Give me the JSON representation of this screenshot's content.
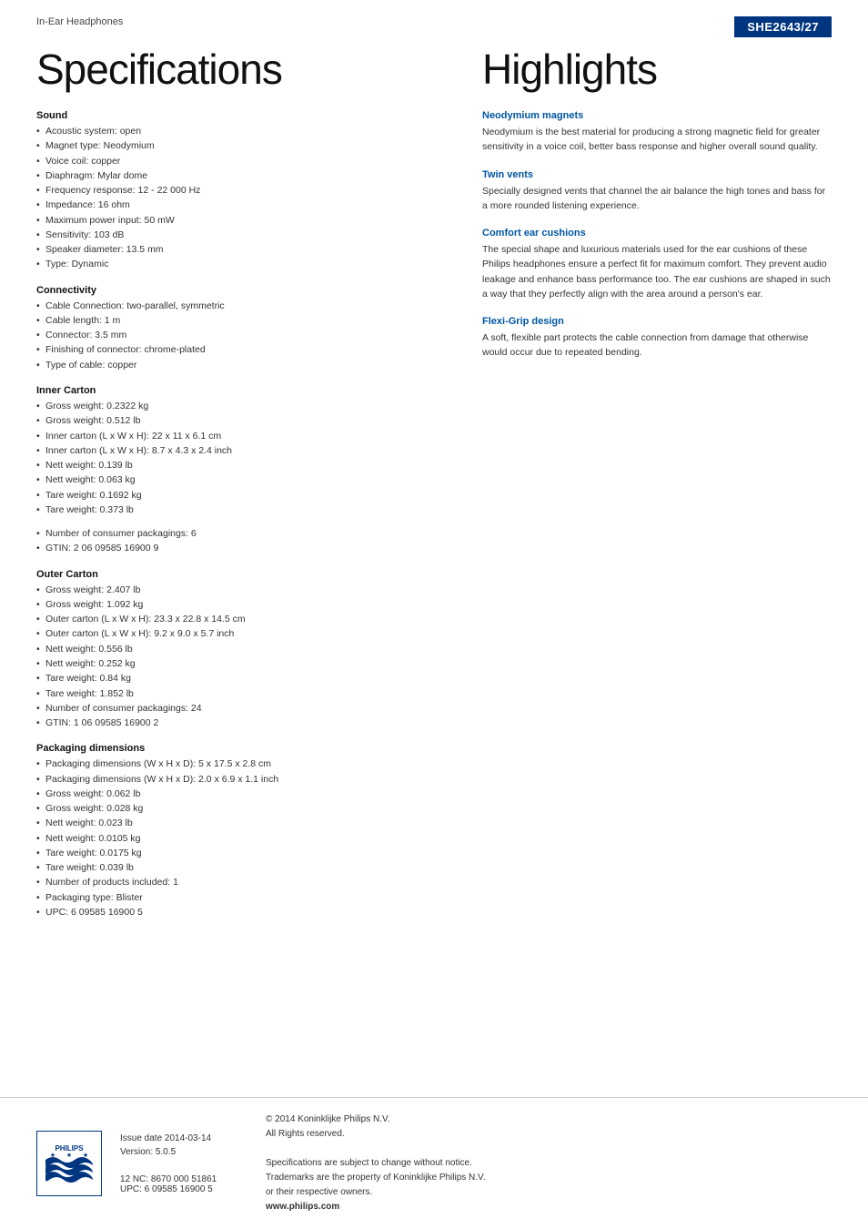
{
  "header": {
    "product_type": "In-Ear Headphones",
    "model": "SHE2643/27"
  },
  "left": {
    "page_title": "Specifications",
    "sections": [
      {
        "title": "Sound",
        "items": [
          "Acoustic system: open",
          "Magnet type: Neodymium",
          "Voice coil: copper",
          "Diaphragm: Mylar dome",
          "Frequency response: 12 - 22 000 Hz",
          "Impedance: 16 ohm",
          "Maximum power input: 50 mW",
          "Sensitivity: 103 dB",
          "Speaker diameter: 13.5 mm",
          "Type: Dynamic"
        ]
      },
      {
        "title": "Connectivity",
        "items": [
          "Cable Connection: two-parallel, symmetric",
          "Cable length: 1 m",
          "Connector: 3.5 mm",
          "Finishing of connector: chrome-plated",
          "Type of cable: copper"
        ]
      },
      {
        "title": "Inner Carton",
        "items": [
          "Gross weight: 0.2322 kg",
          "Gross weight: 0.512 lb",
          "Inner carton (L x W x H): 22 x 11 x 6.1 cm",
          "Inner carton (L x W x H): 8.7 x 4.3 x 2.4 inch",
          "Nett weight: 0.139 lb",
          "Nett weight: 0.063 kg",
          "Tare weight: 0.1692 kg",
          "Tare weight: 0.373 lb"
        ]
      }
    ],
    "middle_items": [
      "Number of consumer packagings: 6",
      "GTIN: 2 06 09585 16900 9"
    ],
    "outer_carton": {
      "title": "Outer Carton",
      "items": [
        "Gross weight: 2.407 lb",
        "Gross weight: 1.092 kg",
        "Outer carton (L x W x H): 23.3 x 22.8 x 14.5 cm",
        "Outer carton (L x W x H): 9.2 x 9.0 x 5.7 inch",
        "Nett weight: 0.556 lb",
        "Nett weight: 0.252 kg",
        "Tare weight: 0.84 kg",
        "Tare weight: 1.852 lb",
        "Number of consumer packagings: 24",
        "GTIN: 1 06 09585 16900 2"
      ]
    },
    "packaging_dimensions": {
      "title": "Packaging dimensions",
      "items": [
        "Packaging dimensions (W x H x D): 5 x 17.5 x 2.8 cm",
        "Packaging dimensions (W x H x D): 2.0 x 6.9 x 1.1 inch",
        "Gross weight: 0.062 lb",
        "Gross weight: 0.028 kg",
        "Nett weight: 0.023 lb",
        "Nett weight: 0.0105 kg",
        "Tare weight: 0.0175 kg",
        "Tare weight: 0.039 lb",
        "Number of products included: 1",
        "Packaging type: Blister",
        "UPC: 6 09585 16900 5"
      ]
    }
  },
  "right": {
    "page_title": "Highlights",
    "highlights": [
      {
        "title": "Neodymium magnets",
        "text": "Neodymium is the best material for producing a strong magnetic field for greater sensitivity in a voice coil, better bass response and higher overall sound quality."
      },
      {
        "title": "Twin vents",
        "text": "Specially designed vents that channel the air balance the high tones and bass for a more rounded listening experience."
      },
      {
        "title": "Comfort ear cushions",
        "text": "The special shape and luxurious materials used for the ear cushions of these Philips headphones ensure a perfect fit for maximum comfort. They prevent audio leakage and enhance bass performance too. The ear cushions are shaped in such a way that they perfectly align with the area around a person's ear."
      },
      {
        "title": "Flexi-Grip design",
        "text": "A soft, flexible part protects the cable connection from damage that otherwise would occur due to repeated bending."
      }
    ]
  },
  "footer": {
    "issue_date_label": "Issue date 2014-03-14",
    "version_label": "Version: 5.0.5",
    "nc_upc": "12 NC: 8670 000 51861\nUPC: 6 09585 16900 5",
    "copyright": "© 2014 Koninklijke Philips N.V.\nAll Rights reserved.",
    "legal": "Specifications are subject to change without notice.\nTrademarks are the property of Koninklijke Philips N.V.\nor their respective owners.",
    "website": "www.philips.com"
  }
}
